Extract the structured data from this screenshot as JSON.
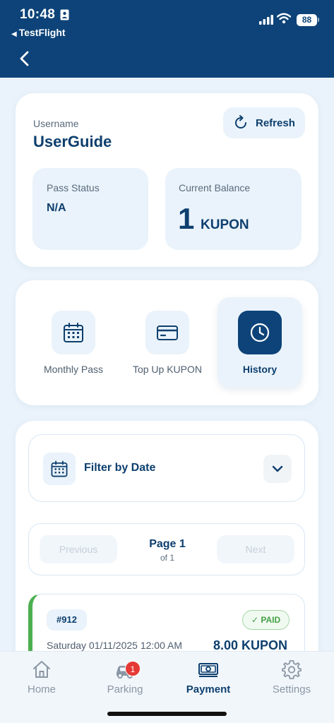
{
  "status_bar": {
    "time": "10:48",
    "back_app": "TestFlight",
    "battery": "88"
  },
  "account": {
    "username_label": "Username",
    "username": "UserGuide",
    "refresh_label": "Refresh",
    "pass_status_label": "Pass Status",
    "pass_status": "N/A",
    "balance_label": "Current Balance",
    "balance_value": "1",
    "balance_unit": "KUPON"
  },
  "menu": {
    "items": [
      {
        "label": "Monthly Pass",
        "icon": "calendar-icon"
      },
      {
        "label": "Top Up KUPON",
        "icon": "credit-card-icon"
      },
      {
        "label": "History",
        "icon": "clock-icon",
        "active": true
      }
    ]
  },
  "filter": {
    "label": "Filter by Date",
    "icon": "calendar-icon"
  },
  "pager": {
    "prev": "Previous",
    "next": "Next",
    "title": "Page 1",
    "subtitle": "of 1"
  },
  "transactions": [
    {
      "id": "#912",
      "status": "✓ PAID",
      "date": "Saturday 01/11/2025 12:00 AM",
      "amount": "8.00 KUPON"
    }
  ],
  "tabbar": {
    "items": [
      {
        "label": "Home",
        "icon": "home-icon"
      },
      {
        "label": "Parking",
        "icon": "car-icon",
        "badge": "1"
      },
      {
        "label": "Payment",
        "icon": "cash-icon",
        "active": true
      },
      {
        "label": "Settings",
        "icon": "gear-icon"
      }
    ]
  },
  "colors": {
    "primary": "#0d4378",
    "paid": "#4caf50",
    "badge": "#e53935",
    "background": "#eaf3fb"
  }
}
